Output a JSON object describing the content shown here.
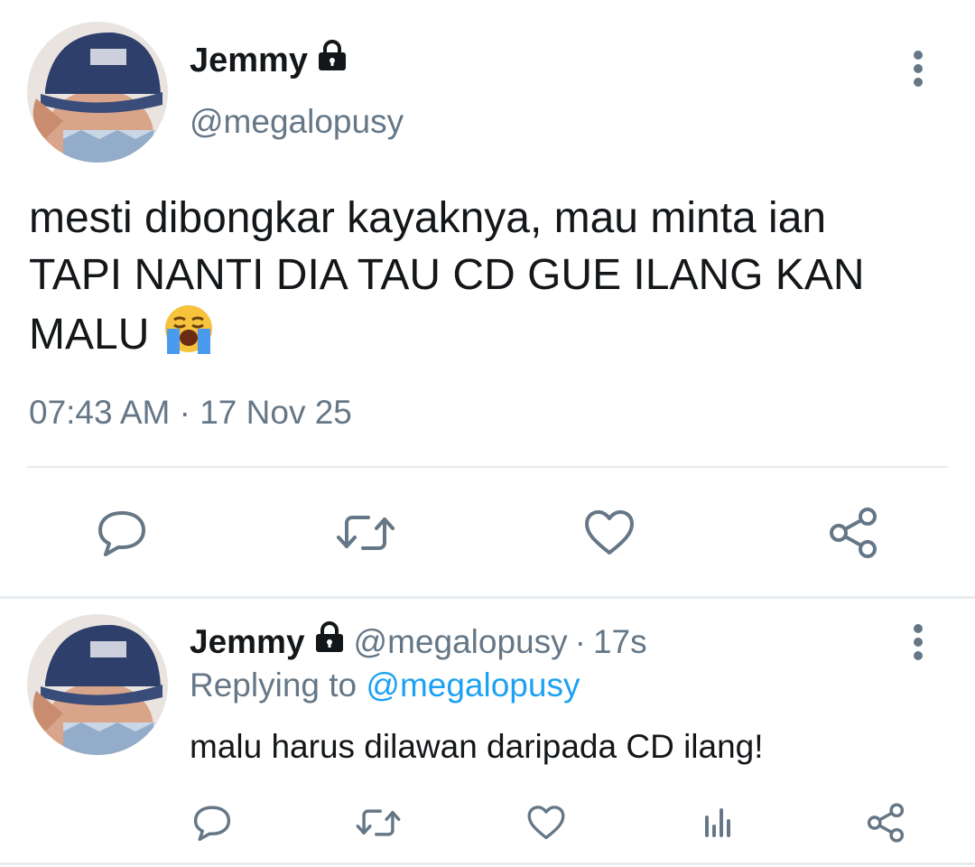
{
  "main_tweet": {
    "author_name": "Jemmy",
    "handle": "@megalopusy",
    "text_lines": [
      "mesti dibongkar kayaknya, mau minta ian",
      "TAPI NANTI DIA TAU CD GUE ILANG KAN",
      "MALU"
    ],
    "emoji": "loudly-crying-face",
    "timestamp": "07:43 AM · 17 Nov 25",
    "icons": [
      "reply-icon",
      "retweet-icon",
      "like-icon",
      "share-icon",
      "more-vertical-icon",
      "lock-icon"
    ]
  },
  "reply_tweet": {
    "author_name": "Jemmy",
    "handle": "@megalopusy",
    "dot": "·",
    "time": "17s",
    "replying_prefix": "Replying to",
    "replying_mention": "@megalopusy",
    "text": "malu harus dilawan daripada CD ilang!",
    "icons": [
      "reply-icon",
      "retweet-icon",
      "like-icon",
      "stats-icon",
      "share-icon",
      "more-vertical-icon",
      "lock-icon"
    ]
  },
  "colors": {
    "text_primary": "#14171a",
    "text_secondary": "#657786",
    "link": "#1da1f2",
    "divider": "#e6ecf0",
    "icon": "#657786"
  }
}
